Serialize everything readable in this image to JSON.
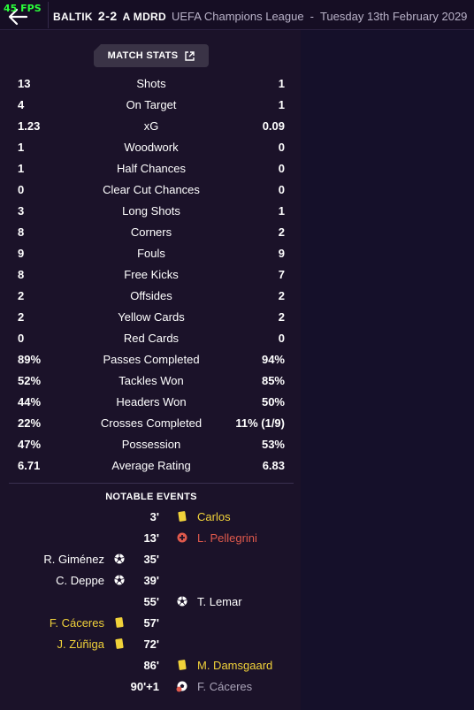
{
  "fps": "45 FPS",
  "header": {
    "home_team": "BALTIK",
    "score": "2-2",
    "away_team": "A MDRD",
    "competition": "UEFA Champions League",
    "separator": "-",
    "date": "Tuesday 13th February 2029"
  },
  "match_stats_button": {
    "label": "MATCH STATS",
    "icon": "popout-icon"
  },
  "stats": [
    {
      "label": "Shots",
      "home": "13",
      "away": "1"
    },
    {
      "label": "On Target",
      "home": "4",
      "away": "1"
    },
    {
      "label": "xG",
      "home": "1.23",
      "away": "0.09"
    },
    {
      "label": "Woodwork",
      "home": "1",
      "away": "0"
    },
    {
      "label": "Half Chances",
      "home": "1",
      "away": "0"
    },
    {
      "label": "Clear Cut Chances",
      "home": "0",
      "away": "0"
    },
    {
      "label": "Long Shots",
      "home": "3",
      "away": "1"
    },
    {
      "label": "Corners",
      "home": "8",
      "away": "2"
    },
    {
      "label": "Fouls",
      "home": "9",
      "away": "9"
    },
    {
      "label": "Free Kicks",
      "home": "8",
      "away": "7"
    },
    {
      "label": "Offsides",
      "home": "2",
      "away": "2"
    },
    {
      "label": "Yellow Cards",
      "home": "2",
      "away": "2"
    },
    {
      "label": "Red Cards",
      "home": "0",
      "away": "0"
    },
    {
      "label": "Passes Completed",
      "home": "89%",
      "away": "94%"
    },
    {
      "label": "Tackles Won",
      "home": "52%",
      "away": "85%"
    },
    {
      "label": "Headers Won",
      "home": "44%",
      "away": "50%"
    },
    {
      "label": "Crosses Completed",
      "home": "22%",
      "away": "11% (1/9)"
    },
    {
      "label": "Possession",
      "home": "47%",
      "away": "53%"
    },
    {
      "label": "Average Rating",
      "home": "6.71",
      "away": "6.83"
    }
  ],
  "notable_events": {
    "title": "NOTABLE EVENTS",
    "events": [
      {
        "minute": "3'",
        "side": "away",
        "player": "Carlos",
        "icon": "yellow-card-icon",
        "color": "#f1d23a"
      },
      {
        "minute": "13'",
        "side": "away",
        "player": "L. Pellegrini",
        "icon": "injury-icon",
        "color": "#e0594c"
      },
      {
        "minute": "35'",
        "side": "home",
        "player": "R. Giménez",
        "icon": "goal-icon",
        "color": "#e8e4ee"
      },
      {
        "minute": "39'",
        "side": "home",
        "player": "C. Deppe",
        "icon": "goal-icon",
        "color": "#e8e4ee"
      },
      {
        "minute": "55'",
        "side": "away",
        "player": "T. Lemar",
        "icon": "goal-icon",
        "color": "#e8e4ee"
      },
      {
        "minute": "57'",
        "side": "home",
        "player": "F. Cáceres",
        "icon": "yellow-card-icon",
        "color": "#f1d23a"
      },
      {
        "minute": "72'",
        "side": "home",
        "player": "J. Zúñiga",
        "icon": "yellow-card-icon",
        "color": "#f1d23a"
      },
      {
        "minute": "86'",
        "side": "away",
        "player": "M. Damsgaard",
        "icon": "yellow-card-icon",
        "color": "#f1d23a"
      },
      {
        "minute": "90'+1",
        "side": "away",
        "player": "F. Cáceres",
        "icon": "own-goal-icon",
        "color": "#aaa4b8"
      }
    ]
  },
  "colors": {
    "background": "#1b1229",
    "panel_right": "#15102a",
    "yellow": "#f1d23a",
    "red": "#e0594c",
    "fps_green": "#2aff3a"
  }
}
